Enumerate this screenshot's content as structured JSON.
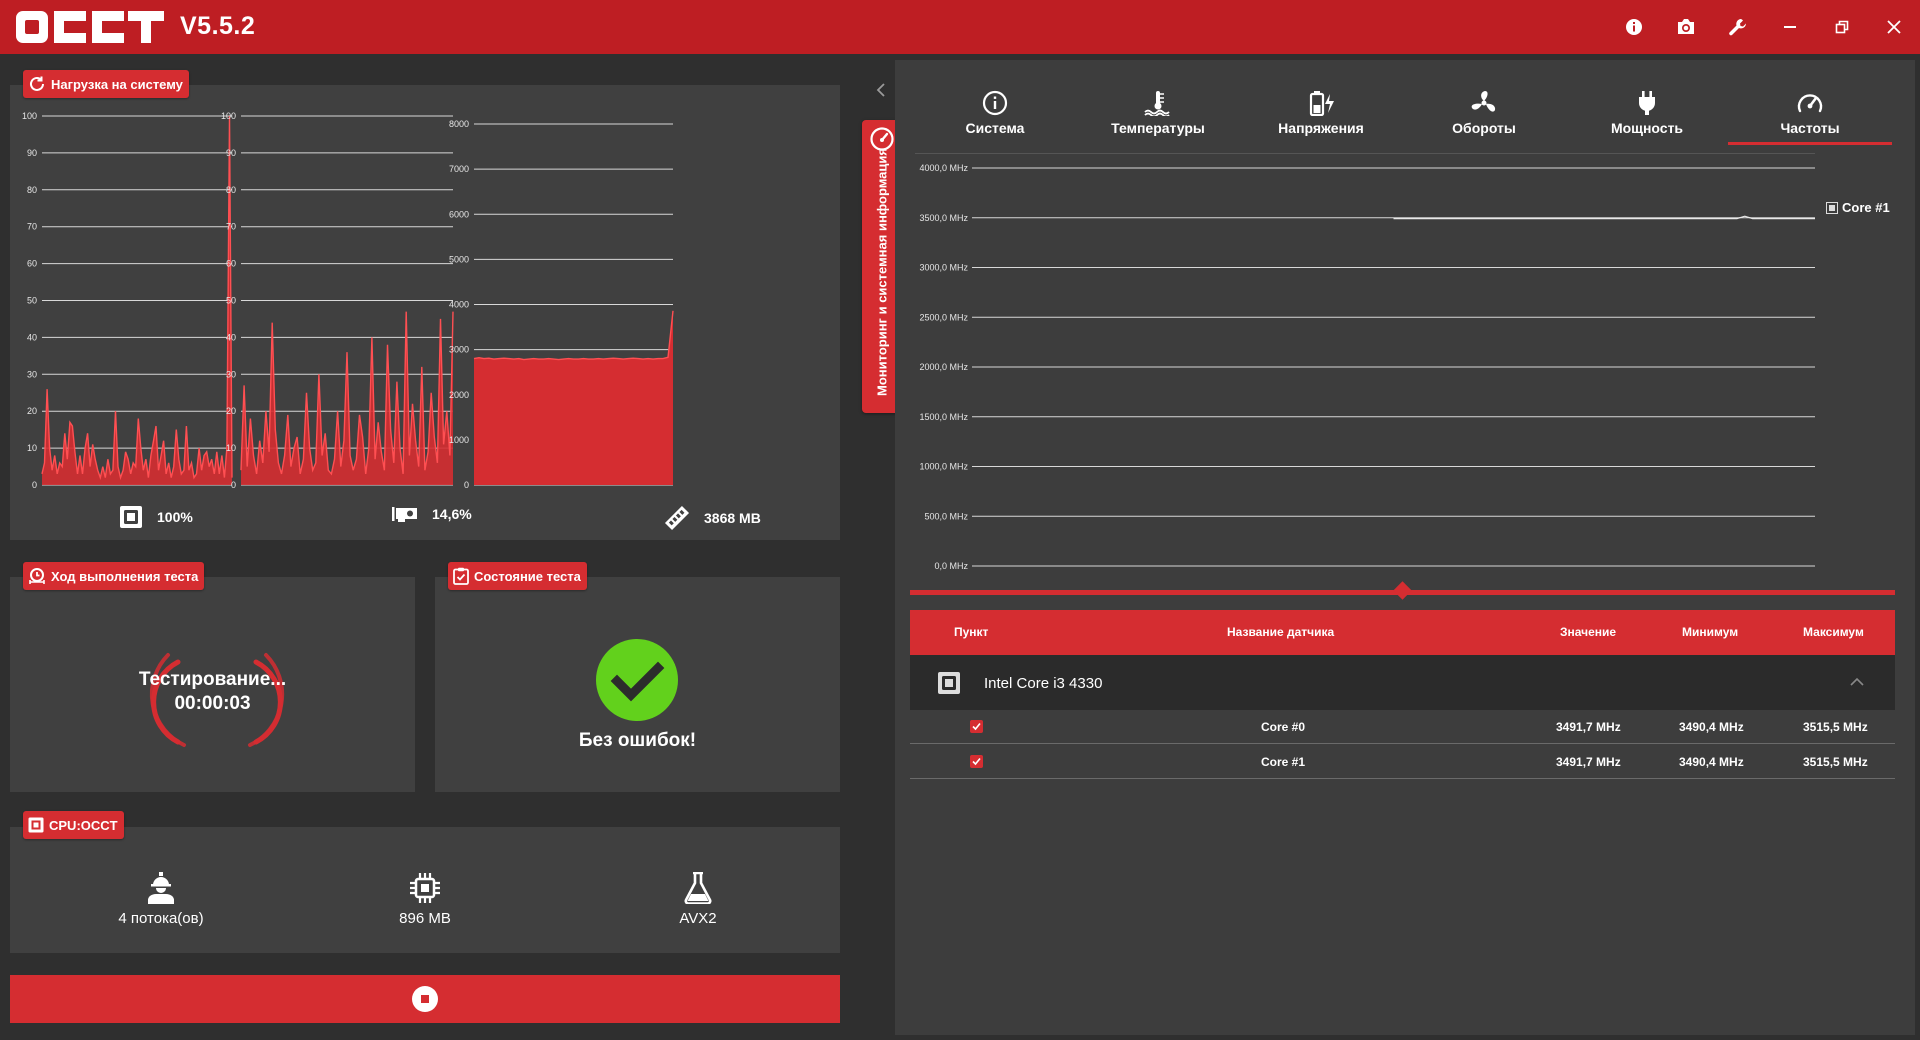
{
  "app": {
    "logo_text": "OCCT",
    "version": "V5.5.2"
  },
  "load_panel": {
    "title": "Нагрузка на систему",
    "charts": [
      {
        "y_ticks": [
          "100",
          "90",
          "80",
          "70",
          "60",
          "50",
          "40",
          "30",
          "20",
          "10",
          "0"
        ],
        "y_max": 100,
        "values": [
          3,
          6,
          26,
          10,
          4,
          8,
          3,
          6,
          5,
          14,
          7,
          17,
          16,
          9,
          3,
          8,
          3,
          10,
          14,
          5,
          11,
          7,
          4,
          2,
          5,
          2,
          7,
          3,
          4,
          20,
          5,
          2,
          4,
          9,
          7,
          3,
          6,
          5,
          18,
          10,
          4,
          7,
          2,
          8,
          12,
          16,
          4,
          8,
          12,
          3,
          6,
          2,
          5,
          15,
          7,
          3,
          4,
          16,
          4,
          6,
          2,
          3,
          10,
          4,
          8,
          9,
          5,
          7,
          3,
          9,
          3,
          8,
          2,
          10,
          100,
          2
        ],
        "readout": "100%"
      },
      {
        "y_ticks": [
          "100",
          "90",
          "80",
          "70",
          "60",
          "50",
          "40",
          "30",
          "20",
          "10",
          "0"
        ],
        "y_max": 100,
        "values": [
          4,
          27,
          5,
          18,
          8,
          3,
          12,
          6,
          20,
          9,
          44,
          15,
          6,
          3,
          8,
          19,
          5,
          10,
          13,
          3,
          7,
          25,
          10,
          4,
          6,
          30,
          8,
          14,
          4,
          3,
          7,
          20,
          5,
          12,
          36,
          8,
          4,
          7,
          19,
          13,
          3,
          10,
          40,
          7,
          17,
          9,
          4,
          38,
          15,
          6,
          28,
          10,
          3,
          47,
          8,
          22,
          12,
          5,
          32,
          4,
          9,
          25,
          13,
          6,
          45,
          11,
          20,
          8,
          47
        ],
        "readout": "14,6%"
      },
      {
        "y_ticks": [
          "8000",
          "7000",
          "6000",
          "5000",
          "4000",
          "3000",
          "2000",
          "1000",
          "0"
        ],
        "y_max": 8000,
        "values": [
          2800,
          2820,
          2800,
          2810,
          2790,
          2800,
          2810,
          2800,
          2790,
          2800,
          2780,
          2790,
          2800,
          2790,
          2790,
          2800,
          2790,
          2780,
          2790,
          2800,
          2790,
          2790,
          2800,
          2790,
          2790,
          2800,
          2790,
          2800,
          2810,
          2800,
          2790,
          2800,
          2810,
          2800,
          2790,
          2800,
          2790,
          2800,
          2800,
          2830,
          3860
        ],
        "readout": "3868 MB"
      }
    ]
  },
  "progress_panel": {
    "title": "Ход выполнения теста",
    "status": "Тестирование...",
    "elapsed": "00:00:03"
  },
  "state_panel": {
    "title": "Состояние теста",
    "result": "Без ошибок!"
  },
  "cpu_panel": {
    "title": "CPU:OCCT",
    "items": [
      {
        "icon": "worker-icon",
        "label": "4 потока(ов)"
      },
      {
        "icon": "chip-icon",
        "label": "896 MB"
      },
      {
        "icon": "flask-icon",
        "label": "AVX2"
      }
    ]
  },
  "side_tab": {
    "label": "Мониторинг и системная информация"
  },
  "monitor": {
    "tabs": [
      {
        "label": "Система",
        "icon": "info-icon"
      },
      {
        "label": "Температуры",
        "icon": "thermometer-icon"
      },
      {
        "label": "Напряжения",
        "icon": "battery-bolt-icon"
      },
      {
        "label": "Обороты",
        "icon": "fan-icon"
      },
      {
        "label": "Мощность",
        "icon": "plug-icon"
      },
      {
        "label": "Частоты",
        "icon": "speedometer-icon"
      }
    ],
    "active_tab": 5,
    "chart": {
      "y_ticks": [
        "4000,0 MHz",
        "3500,0 MHz",
        "3000,0 MHz",
        "2500,0 MHz",
        "2000,0 MHz",
        "1500,0 MHz",
        "1000,0 MHz",
        "500,0 MHz",
        "0,0 MHz"
      ],
      "y_max": 4000,
      "series_name": "Core #1",
      "values": [
        3491.7,
        3491.7,
        3491.7,
        3491.7,
        3491.7,
        3491.7,
        3491.7,
        3491.7,
        3491.7,
        3491.7,
        3491.7,
        3491.7,
        3491.7,
        3491.7,
        3491.7,
        3491.7,
        3491.7,
        3491.7,
        3491.7,
        3491.7,
        3491.7,
        3491.7,
        3491.7,
        3491.7,
        3491.7,
        3491.7,
        3491.7,
        3491.7,
        3491.7,
        3491.7,
        3491.7,
        3491.7,
        3491.7,
        3491.7,
        3491.7,
        3491.7,
        3491.7,
        3491.7,
        3491.7,
        3491.7,
        3491.7,
        3491.7,
        3491.7,
        3491.7,
        3491.7,
        3515.5,
        3491.7,
        3491.7,
        3491.7,
        3491.7,
        3491.7,
        3491.7,
        3491.7,
        3491.7,
        3491.7
      ],
      "line_start_fraction": 0.5
    },
    "table": {
      "headers": {
        "item": "Пункт",
        "sensor": "Название датчика",
        "value": "Значение",
        "min": "Минимум",
        "max": "Максимум"
      },
      "group": "Intel Core i3 4330",
      "rows": [
        {
          "name": "Core #0",
          "value": "3491,7 MHz",
          "min": "3490,4 MHz",
          "max": "3515,5 MHz"
        },
        {
          "name": "Core #1",
          "value": "3491,7 MHz",
          "min": "3490,4 MHz",
          "max": "3515,5 MHz"
        }
      ]
    }
  },
  "colors": {
    "accent": "#d52d31",
    "titlebar": "#be1e23",
    "panel": "#404040",
    "ok_green": "#62d11c",
    "line_bright": "#ff4f52"
  }
}
